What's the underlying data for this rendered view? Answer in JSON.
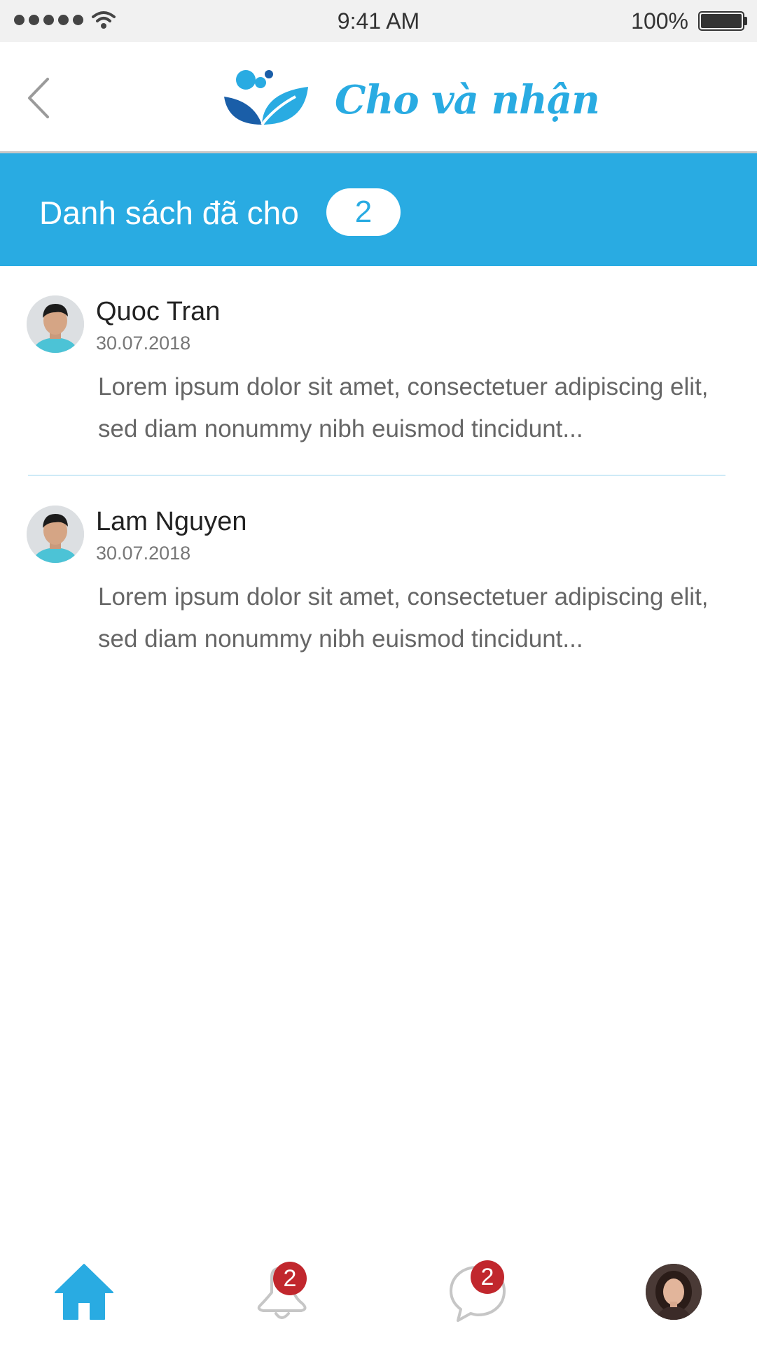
{
  "status_bar": {
    "time": "9:41 AM",
    "battery": "100%"
  },
  "header": {
    "app_name": "Cho và nhận",
    "back_icon": "chevron-left-icon",
    "logo_icon": "leaf-bubbles-icon"
  },
  "section": {
    "title": "Danh sách đã cho",
    "count": "2"
  },
  "items": [
    {
      "name": "Quoc Tran",
      "date": "30.07.2018",
      "text": "Lorem ipsum dolor sit amet, consectetuer adipiscing elit, sed diam nonummy nibh euismod tincidunt..."
    },
    {
      "name": "Lam Nguyen",
      "date": "30.07.2018",
      "text": "Lorem ipsum dolor sit amet, consectetuer adipiscing elit, sed diam nonummy nibh euismod tincidunt..."
    }
  ],
  "tab_bar": {
    "notifications_badge": "2",
    "messages_badge": "2",
    "icons": [
      "home-icon",
      "bell-icon",
      "chat-bubble-icon",
      "profile-avatar"
    ]
  },
  "colors": {
    "accent": "#29abe2",
    "badge_red": "#c1272d",
    "text_dark": "#222222",
    "text_muted": "#666666"
  }
}
